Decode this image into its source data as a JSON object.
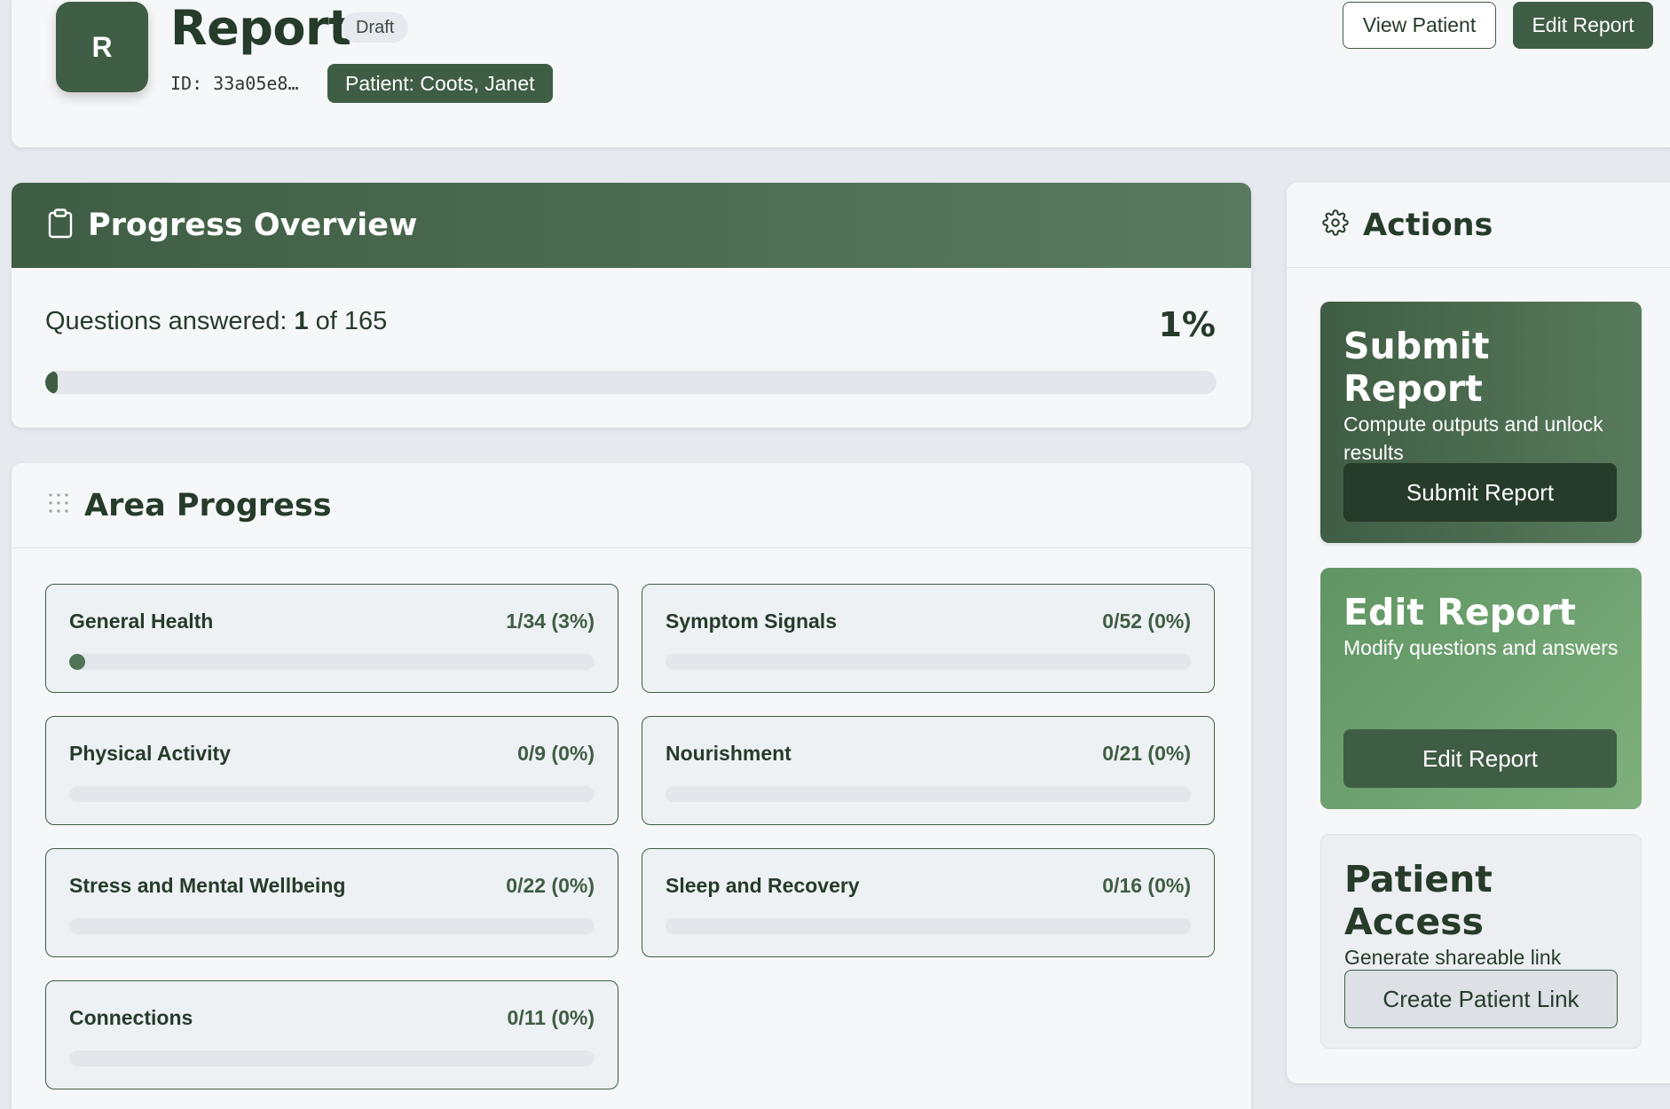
{
  "header": {
    "avatar_letter": "R",
    "title": "Report",
    "status_badge": "Draft",
    "id_text": "ID: 33a05e8…",
    "patient_chip": "Patient: Coots, Janet",
    "view_patient_label": "View Patient",
    "edit_report_label": "Edit Report"
  },
  "progress": {
    "title": "Progress Overview",
    "icon": "clipboard-icon",
    "answered_prefix": "Questions answered: ",
    "answered": "1",
    "of_text": " of 165",
    "percent_label": "1%",
    "fraction": 0.006
  },
  "areas": {
    "title": "Area Progress",
    "icon": "grid-dots-icon",
    "items": [
      {
        "name": "General Health",
        "count": "1/34 (3%)",
        "fraction": 0.03
      },
      {
        "name": "Symptom Signals",
        "count": "0/52 (0%)",
        "fraction": 0
      },
      {
        "name": "Physical Activity",
        "count": "0/9 (0%)",
        "fraction": 0
      },
      {
        "name": "Nourishment",
        "count": "0/21 (0%)",
        "fraction": 0
      },
      {
        "name": "Stress and Mental Wellbeing",
        "count": "0/22 (0%)",
        "fraction": 0
      },
      {
        "name": "Sleep and Recovery",
        "count": "0/16 (0%)",
        "fraction": 0
      },
      {
        "name": "Connections",
        "count": "0/11 (0%)",
        "fraction": 0
      }
    ]
  },
  "actions": {
    "title": "Actions",
    "icon": "gear-icon",
    "submit": {
      "title": "Submit Report",
      "desc": "Compute outputs and unlock results",
      "button": "Submit Report"
    },
    "edit": {
      "title": "Edit Report",
      "desc": "Modify questions and answers",
      "button": "Edit Report"
    },
    "access": {
      "title": "Patient Access",
      "desc": "Generate shareable link",
      "button": "Create Patient Link"
    }
  },
  "colors": {
    "primary": "#3f5d44",
    "primary_dark": "#263b2a",
    "accent_light": "#7fb07e",
    "background": "#e6e9ee"
  }
}
